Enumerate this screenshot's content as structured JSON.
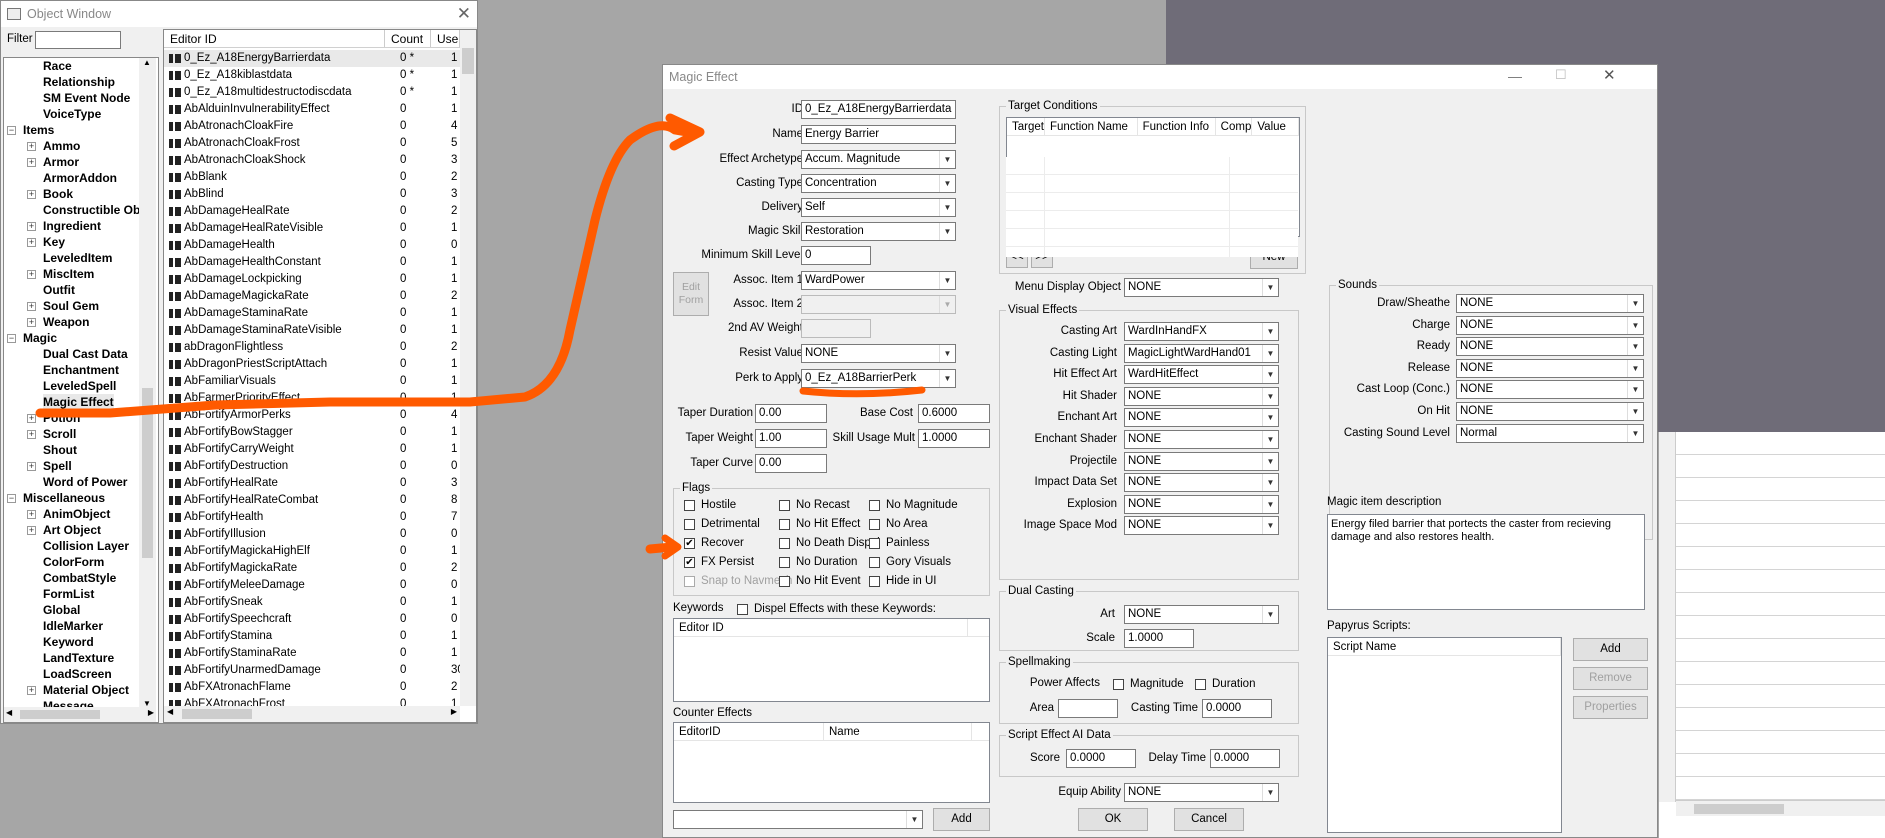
{
  "object_window": {
    "title": "Object Window",
    "filter_label": "Filter",
    "filter_value": "",
    "tree": [
      {
        "label": "Race",
        "level": 1,
        "expander": false
      },
      {
        "label": "Relationship",
        "level": 1,
        "expander": false
      },
      {
        "label": "SM Event Node",
        "level": 1,
        "expander": false
      },
      {
        "label": "VoiceType",
        "level": 1,
        "expander": false
      },
      {
        "label": "Items",
        "level": 0,
        "expander": true,
        "expanded": true
      },
      {
        "label": "Ammo",
        "level": 1,
        "expander": true
      },
      {
        "label": "Armor",
        "level": 1,
        "expander": true
      },
      {
        "label": "ArmorAddon",
        "level": 1,
        "expander": false
      },
      {
        "label": "Book",
        "level": 1,
        "expander": true
      },
      {
        "label": "Constructible Ob",
        "level": 1,
        "expander": false
      },
      {
        "label": "Ingredient",
        "level": 1,
        "expander": true
      },
      {
        "label": "Key",
        "level": 1,
        "expander": true
      },
      {
        "label": "LeveledItem",
        "level": 1,
        "expander": false
      },
      {
        "label": "MiscItem",
        "level": 1,
        "expander": true
      },
      {
        "label": "Outfit",
        "level": 1,
        "expander": false
      },
      {
        "label": "Soul Gem",
        "level": 1,
        "expander": true
      },
      {
        "label": "Weapon",
        "level": 1,
        "expander": true
      },
      {
        "label": "Magic",
        "level": 0,
        "expander": true,
        "expanded": true
      },
      {
        "label": "Dual Cast Data",
        "level": 1,
        "expander": false
      },
      {
        "label": "Enchantment",
        "level": 1,
        "expander": false
      },
      {
        "label": "LeveledSpell",
        "level": 1,
        "expander": false
      },
      {
        "label": "Magic Effect",
        "level": 1,
        "expander": false
      },
      {
        "label": "Potion",
        "level": 1,
        "expander": true
      },
      {
        "label": "Scroll",
        "level": 1,
        "expander": true
      },
      {
        "label": "Shout",
        "level": 1,
        "expander": false
      },
      {
        "label": "Spell",
        "level": 1,
        "expander": true
      },
      {
        "label": "Word of Power",
        "level": 1,
        "expander": false
      },
      {
        "label": "Miscellaneous",
        "level": 0,
        "expander": true,
        "expanded": true
      },
      {
        "label": "AnimObject",
        "level": 1,
        "expander": true
      },
      {
        "label": "Art Object",
        "level": 1,
        "expander": true
      },
      {
        "label": "Collision Layer",
        "level": 1,
        "expander": false
      },
      {
        "label": "ColorForm",
        "level": 1,
        "expander": false
      },
      {
        "label": "CombatStyle",
        "level": 1,
        "expander": false
      },
      {
        "label": "FormList",
        "level": 1,
        "expander": false
      },
      {
        "label": "Global",
        "level": 1,
        "expander": false
      },
      {
        "label": "IdleMarker",
        "level": 1,
        "expander": false
      },
      {
        "label": "Keyword",
        "level": 1,
        "expander": false
      },
      {
        "label": "LandTexture",
        "level": 1,
        "expander": false
      },
      {
        "label": "LoadScreen",
        "level": 1,
        "expander": false
      },
      {
        "label": "Material Object",
        "level": 1,
        "expander": true
      },
      {
        "label": "Message",
        "level": 1,
        "expander": false
      }
    ],
    "columns": [
      "Editor ID",
      "Count",
      "Use"
    ],
    "rows": [
      [
        "0_Ez_A18EnergyBarrierdata",
        "0 *",
        "1"
      ],
      [
        "0_Ez_A18kiblastdata",
        "0 *",
        "1"
      ],
      [
        "0_Ez_A18multidestructodiscdata",
        "0 *",
        "1"
      ],
      [
        "AbAlduinInvulnerabilityEffect",
        "0",
        "1"
      ],
      [
        "AbAtronachCloakFire",
        "0",
        "4"
      ],
      [
        "AbAtronachCloakFrost",
        "0",
        "5"
      ],
      [
        "AbAtronachCloakShock",
        "0",
        "3"
      ],
      [
        "AbBlank",
        "0",
        "2"
      ],
      [
        "AbBlind",
        "0",
        "3"
      ],
      [
        "AbDamageHealRate",
        "0",
        "2"
      ],
      [
        "AbDamageHealRateVisible",
        "0",
        "1"
      ],
      [
        "AbDamageHealth",
        "0",
        "0"
      ],
      [
        "AbDamageHealthConstant",
        "0",
        "1"
      ],
      [
        "AbDamageLockpicking",
        "0",
        "1"
      ],
      [
        "AbDamageMagickaRate",
        "0",
        "2"
      ],
      [
        "AbDamageStaminaRate",
        "0",
        "1"
      ],
      [
        "AbDamageStaminaRateVisible",
        "0",
        "1"
      ],
      [
        "abDragonFlightless",
        "0",
        "2"
      ],
      [
        "AbDragonPriestScriptAttach",
        "0",
        "1"
      ],
      [
        "AbFamiliarVisuals",
        "0",
        "1"
      ],
      [
        "AbFarmerPriorityEffect",
        "0",
        "1"
      ],
      [
        "AbFortifyArmorPerks",
        "0",
        "4"
      ],
      [
        "AbFortifyBowStagger",
        "0",
        "1"
      ],
      [
        "AbFortifyCarryWeight",
        "0",
        "1"
      ],
      [
        "AbFortifyDestruction",
        "0",
        "0"
      ],
      [
        "AbFortifyHealRate",
        "0",
        "3"
      ],
      [
        "AbFortifyHealRateCombat",
        "0",
        "8"
      ],
      [
        "AbFortifyHealth",
        "0",
        "7"
      ],
      [
        "AbFortifyIllusion",
        "0",
        "0"
      ],
      [
        "AbFortifyMagickaHighElf",
        "0",
        "1"
      ],
      [
        "AbFortifyMagickaRate",
        "0",
        "2"
      ],
      [
        "AbFortifyMeleeDamage",
        "0",
        "0"
      ],
      [
        "AbFortifySneak",
        "0",
        "1"
      ],
      [
        "AbFortifySpeechcraft",
        "0",
        "0"
      ],
      [
        "AbFortifyStamina",
        "0",
        "1"
      ],
      [
        "AbFortifyStaminaRate",
        "0",
        "1"
      ],
      [
        "AbFortifyUnarmedDamage",
        "0",
        "30"
      ],
      [
        "AbFXAtronachFlame",
        "0",
        "2"
      ],
      [
        "AbFXAtronachFrost",
        "0",
        "1"
      ]
    ]
  },
  "magic_effect": {
    "title": "Magic Effect",
    "fields": {
      "id": {
        "label": "ID",
        "value": "0_Ez_A18EnergyBarrierdata"
      },
      "name": {
        "label": "Name",
        "value": "Energy Barrier"
      },
      "effect_archetype": {
        "label": "Effect Archetype",
        "value": "Accum. Magnitude"
      },
      "casting_type": {
        "label": "Casting Type",
        "value": "Concentration"
      },
      "delivery": {
        "label": "Delivery",
        "value": "Self"
      },
      "magic_skill": {
        "label": "Magic Skill",
        "value": "Restoration"
      },
      "min_skill_level": {
        "label": "Minimum Skill Level",
        "value": "0"
      },
      "edit_form_button": "Edit Form",
      "assoc_item_1": {
        "label": "Assoc. Item 1",
        "value": "WardPower"
      },
      "assoc_item_2": {
        "label": "Assoc. Item 2",
        "value": ""
      },
      "second_av_weight": {
        "label": "2nd AV Weight",
        "value": ""
      },
      "resist_value": {
        "label": "Resist Value",
        "value": "NONE"
      },
      "perk_to_apply": {
        "label": "Perk to Apply",
        "value": "0_Ez_A18BarrierPerk"
      },
      "taper_duration": {
        "label": "Taper Duration",
        "value": "0.00"
      },
      "base_cost": {
        "label": "Base Cost",
        "value": "0.6000"
      },
      "taper_weight": {
        "label": "Taper Weight",
        "value": "1.00"
      },
      "skill_usage_mult": {
        "label": "Skill Usage Mult",
        "value": "1.0000"
      },
      "taper_curve": {
        "label": "Taper Curve",
        "value": "0.00"
      }
    },
    "flags": {
      "title": "Flags",
      "items": [
        {
          "label": "Hostile",
          "checked": false,
          "disabled": false
        },
        {
          "label": "No Recast",
          "checked": false,
          "disabled": false
        },
        {
          "label": "No Magnitude",
          "checked": false,
          "disabled": false
        },
        {
          "label": "Detrimental",
          "checked": false,
          "disabled": false
        },
        {
          "label": "No Hit Effect",
          "checked": false,
          "disabled": false
        },
        {
          "label": "No Area",
          "checked": false,
          "disabled": false
        },
        {
          "label": "Recover",
          "checked": true,
          "disabled": false
        },
        {
          "label": "No Death Dispel",
          "checked": false,
          "disabled": false
        },
        {
          "label": "Painless",
          "checked": false,
          "disabled": false
        },
        {
          "label": "FX Persist",
          "checked": true,
          "disabled": false
        },
        {
          "label": "No Duration",
          "checked": false,
          "disabled": false
        },
        {
          "label": "Gory Visuals",
          "checked": false,
          "disabled": false
        },
        {
          "label": "Snap to Navmesh",
          "checked": false,
          "disabled": true
        },
        {
          "label": "No Hit Event",
          "checked": false,
          "disabled": false
        },
        {
          "label": "Hide in UI",
          "checked": false,
          "disabled": false
        }
      ]
    },
    "keywords": {
      "title": "Keywords",
      "dispel_label": "Dispel Effects with these Keywords:",
      "column": "Editor ID"
    },
    "counter_effects": {
      "title": "Counter Effects",
      "columns": [
        "EditorID",
        "Name"
      ],
      "add_button": "Add"
    },
    "target_conditions": {
      "title": "Target Conditions",
      "columns": [
        "Target",
        "Function Name",
        "Function Info",
        "Comp",
        "Value",
        ""
      ],
      "prev": "<<",
      "next": ">>",
      "new_button": "New"
    },
    "menu_display_object": {
      "label": "Menu Display Object",
      "value": "NONE"
    },
    "visual_effects": {
      "title": "Visual Effects",
      "items": [
        {
          "label": "Casting Art",
          "value": "WardInHandFX"
        },
        {
          "label": "Casting Light",
          "value": "MagicLightWardHand01"
        },
        {
          "label": "Hit Effect Art",
          "value": "WardHitEffect"
        },
        {
          "label": "Hit Shader",
          "value": "NONE"
        },
        {
          "label": "Enchant Art",
          "value": "NONE"
        },
        {
          "label": "Enchant Shader",
          "value": "NONE"
        },
        {
          "label": "Projectile",
          "value": "NONE"
        },
        {
          "label": "Impact Data Set",
          "value": "NONE"
        },
        {
          "label": "Explosion",
          "value": "NONE"
        },
        {
          "label": "Image Space Mod",
          "value": "NONE"
        }
      ]
    },
    "dual_casting": {
      "title": "Dual Casting",
      "art_label": "Art",
      "art_value": "NONE",
      "scale_label": "Scale",
      "scale_value": "1.0000"
    },
    "spellmaking": {
      "title": "Spellmaking",
      "power_affects": "Power Affects",
      "magnitude": "Magnitude",
      "duration": "Duration",
      "area_label": "Area",
      "area_value": "",
      "casting_time_label": "Casting Time",
      "casting_time_value": "0.0000"
    },
    "script_ai": {
      "title": "Script Effect AI Data",
      "score_label": "Score",
      "score_value": "0.0000",
      "delay_label": "Delay Time",
      "delay_value": "0.0000"
    },
    "equip_ability": {
      "label": "Equip Ability",
      "value": "NONE"
    },
    "sounds": {
      "title": "Sounds",
      "items": [
        {
          "label": "Draw/Sheathe",
          "value": "NONE"
        },
        {
          "label": "Charge",
          "value": "NONE"
        },
        {
          "label": "Ready",
          "value": "NONE"
        },
        {
          "label": "Release",
          "value": "NONE"
        },
        {
          "label": "Cast Loop (Conc.)",
          "value": "NONE"
        },
        {
          "label": "On Hit",
          "value": "NONE"
        },
        {
          "label": "Casting Sound Level",
          "value": "Normal"
        }
      ]
    },
    "description": {
      "label": "Magic item description",
      "value": "Energy filed barrier that portects the caster from recieving damage and also restores health."
    },
    "papyrus": {
      "label": "Papyrus Scripts:",
      "column": "Script Name",
      "add": "Add",
      "remove": "Remove",
      "properties": "Properties"
    },
    "ok": "OK",
    "cancel": "Cancel"
  },
  "colors": {
    "annotation": "#ff5a00",
    "desktop": "#a6a6a6",
    "desktop_dark": "#6f6c78"
  }
}
